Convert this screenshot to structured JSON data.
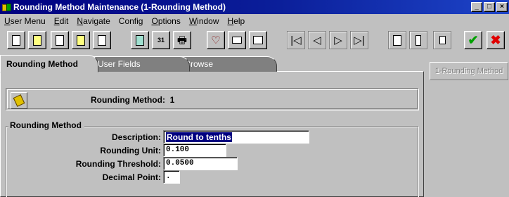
{
  "window": {
    "title": "Rounding Method Maintenance (1-Rounding Method)",
    "minimize": "_",
    "restore": "□",
    "close": "×"
  },
  "menu": [
    {
      "label": "User Menu",
      "ul": "U",
      "rest": "ser Menu"
    },
    {
      "label": "Edit",
      "ul": "E",
      "rest": "dit"
    },
    {
      "label": "Navigate",
      "ul": "N",
      "rest": "avigate"
    },
    {
      "label": "Config",
      "ul": "",
      "rest": "Config"
    },
    {
      "label": "Options",
      "ul": "O",
      "rest": "ptions"
    },
    {
      "label": "Window",
      "ul": "W",
      "rest": "indow"
    },
    {
      "label": "Help",
      "ul": "H",
      "rest": "elp"
    }
  ],
  "toolbar": {
    "icons": [
      "copy-icon",
      "paste-icon",
      "find-icon",
      "edit-icon",
      "lookup-icon",
      "calculator-icon",
      "calendar-icon",
      "print-icon",
      "filter-icon",
      "attachment-icon",
      "report-icon",
      "first-record-icon",
      "previous-record-icon",
      "next-record-icon",
      "last-record-icon",
      "new-record-icon",
      "save-icon",
      "delete-icon",
      "ok-icon",
      "cancel-icon"
    ],
    "glyphs": {
      "first": "|◁",
      "prev": "◁",
      "next": "▷",
      "last": "▷|",
      "ok": "✔",
      "cancel": "✖",
      "filter": "♡",
      "print": "🖶",
      "calendar": "31"
    }
  },
  "tabs": [
    "Rounding Method",
    "User Fields",
    "Browse"
  ],
  "side_button": "1-Rounding Method",
  "header": {
    "label": "Rounding Method:",
    "value": "1"
  },
  "group": {
    "legend": "Rounding Method",
    "fields": {
      "description": {
        "label": "Description:",
        "value": "Round to tenths"
      },
      "rounding_unit": {
        "label": "Rounding Unit:",
        "value": "0.100"
      },
      "rounding_threshold": {
        "label": "Rounding Threshold:",
        "value": "0.0500"
      },
      "decimal_point": {
        "label": "Decimal Point:",
        "value": "."
      }
    }
  }
}
